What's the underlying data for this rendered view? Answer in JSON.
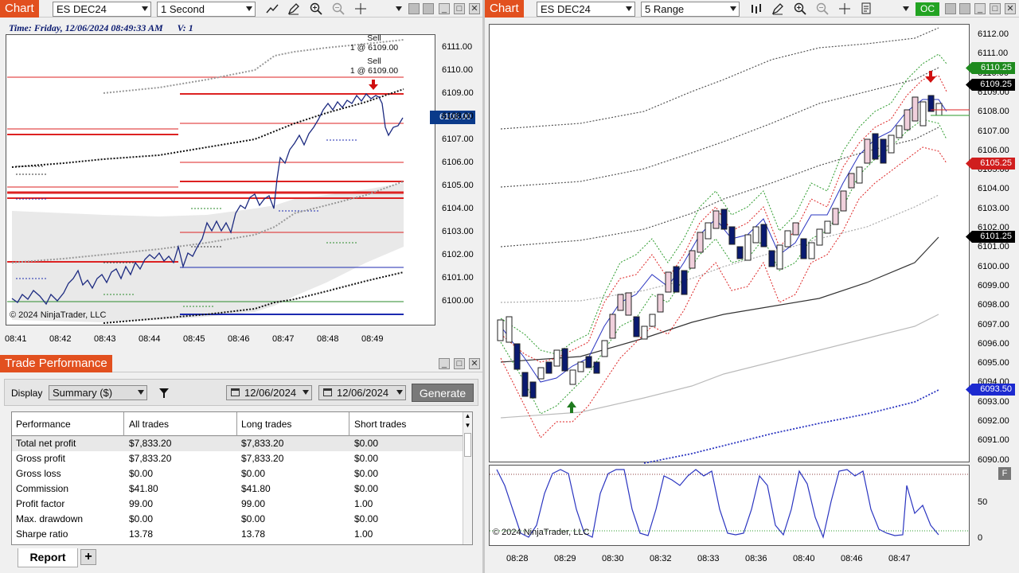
{
  "left_chart": {
    "title_tab": "Chart",
    "instrument": "ES DEC24",
    "interval": "1 Second",
    "info_time": "Time: Friday, 12/06/2024 08:49:33 AM",
    "info_v": "V: 1",
    "copyright": "© 2024 NinjaTrader, LLC",
    "price_ticks": [
      "6111.00",
      "6110.00",
      "6109.00",
      "6108.00",
      "6107.00",
      "6106.00",
      "6105.00",
      "6104.00",
      "6103.00",
      "6102.00",
      "6101.00",
      "6100.00"
    ],
    "current_price": "6108.00",
    "time_ticks": [
      "08:41",
      "08:42",
      "08:43",
      "08:44",
      "08:45",
      "08:46",
      "08:47",
      "08:48",
      "08:49"
    ],
    "annotations": [
      {
        "line1": "Sell",
        "line2": "1 @ 6109.00"
      },
      {
        "line1": "Sell",
        "line2": "1 @ 6109.00"
      }
    ],
    "icons": [
      "line-tool-icon",
      "pencil-icon",
      "zoom-in-icon",
      "zoom-out-icon",
      "crosshair-icon",
      "chevron-down-icon"
    ],
    "colors": {
      "accent": "#e2501f",
      "price_tag": "#0a3a8a",
      "sell_arrow": "#d01010"
    }
  },
  "right_chart": {
    "title_tab": "Chart",
    "instrument": "ES DEC24",
    "interval": "5 Range",
    "oc_label": "OC",
    "copyright": "© 2024 NinjaTrader, LLC",
    "price_ticks": [
      "6112.00",
      "6111.00",
      "6110.00",
      "6109.00",
      "6108.00",
      "6107.00",
      "6106.00",
      "6105.00",
      "6104.00",
      "6103.00",
      "6102.00",
      "6101.00",
      "6100.00",
      "6099.00",
      "6098.00",
      "6097.00",
      "6096.00",
      "6095.00",
      "6094.00",
      "6093.00",
      "6092.00",
      "6091.00",
      "6090.00"
    ],
    "tags": [
      {
        "text": "6110.25",
        "color": "#1e8a1e"
      },
      {
        "text": "6109.25",
        "color": "#000000"
      },
      {
        "text": "6105.25",
        "color": "#d01e1e"
      },
      {
        "text": "6101.25",
        "color": "#000000"
      },
      {
        "text": "6093.50",
        "color": "#1c2ad0"
      }
    ],
    "time_ticks": [
      "08:28",
      "08:29",
      "08:30",
      "08:32",
      "08:33",
      "08:36",
      "08:40",
      "08:46",
      "08:47"
    ],
    "osc_ticks": [
      "50",
      "0"
    ],
    "osc_button": "F",
    "icons": [
      "bar-chart-icon",
      "pencil-icon",
      "zoom-in-icon",
      "zoom-out-icon",
      "crosshair-icon",
      "properties-icon",
      "chevron-down-icon"
    ]
  },
  "trade_performance": {
    "title": "Trade Performance",
    "display_label": "Display",
    "display_value": "Summary ($)",
    "date_from": "12/06/2024",
    "date_to": "12/06/2024",
    "generate_label": "Generate",
    "columns": [
      "Performance",
      "All trades",
      "Long trades",
      "Short trades"
    ],
    "rows": [
      [
        "Total net profit",
        "$7,833.20",
        "$7,833.20",
        "$0.00"
      ],
      [
        "Gross profit",
        "$7,833.20",
        "$7,833.20",
        "$0.00"
      ],
      [
        "Gross loss",
        "$0.00",
        "$0.00",
        "$0.00"
      ],
      [
        "Commission",
        "$41.80",
        "$41.80",
        "$0.00"
      ],
      [
        "Profit factor",
        "99.00",
        "99.00",
        "1.00"
      ],
      [
        "Max. drawdown",
        "$0.00",
        "$0.00",
        "$0.00"
      ],
      [
        "Sharpe ratio",
        "13.78",
        "13.78",
        "1.00"
      ]
    ],
    "tabs": [
      "Report"
    ],
    "add_tab": "+"
  }
}
